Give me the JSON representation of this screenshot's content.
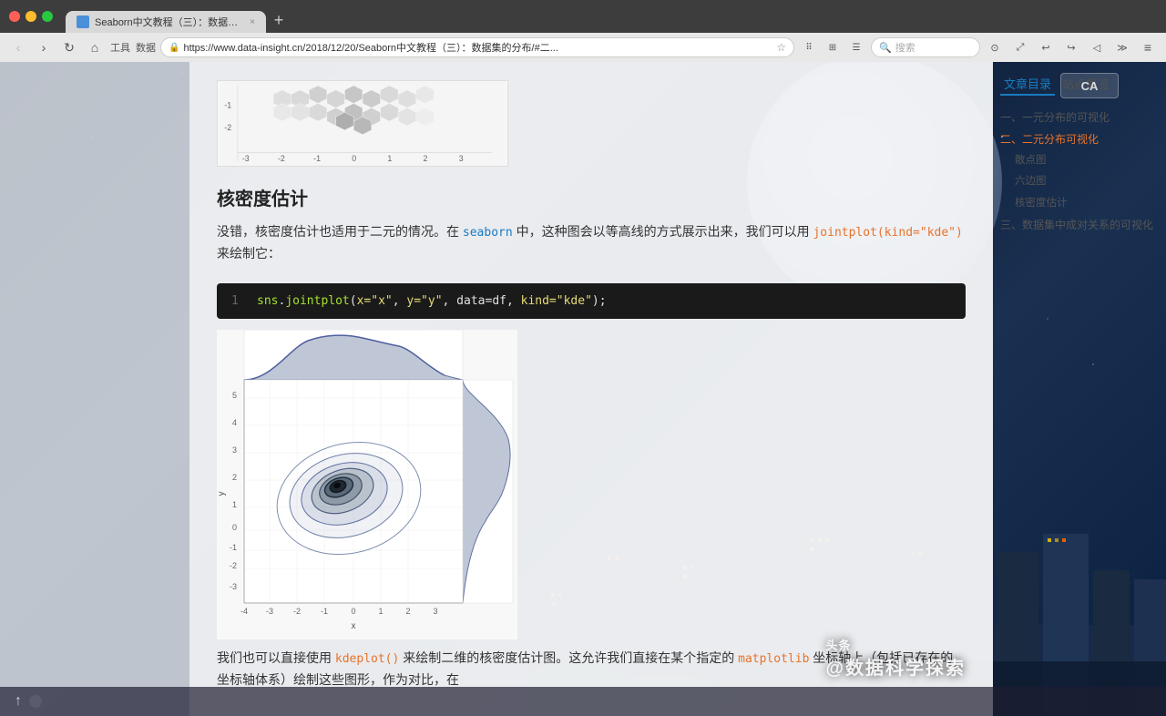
{
  "browser": {
    "tab_title": "Seaborn中文教程（三）：数据集...",
    "tab_close": "×",
    "new_tab": "+",
    "nav": {
      "back": "‹",
      "forward": "›",
      "reload": "↻",
      "home": "⌂",
      "tools": "工具",
      "data": "数据"
    },
    "url": "https://www.data-insight.cn/2018/12/20/Seaborn中文教程（三）：数据集的分布/#二...",
    "search_placeholder": "搜索"
  },
  "toc": {
    "tab1": "文章目录",
    "tab2": "站点概览",
    "items": [
      {
        "label": "一、一元分布的可视化",
        "level": 1,
        "active": false
      },
      {
        "label": "二、二元分布可视化",
        "level": 1,
        "active": true
      },
      {
        "label": "散点图",
        "level": 2,
        "active": false
      },
      {
        "label": "六边图",
        "level": 2,
        "active": false
      },
      {
        "label": "核密度估计",
        "level": 2,
        "active": false
      },
      {
        "label": "三、数据集中成对关系的可视化",
        "level": 1,
        "active": false
      }
    ]
  },
  "article": {
    "heading": "核密度估计",
    "para1": "没错，核密度估计也适用于二元的情况。在",
    "seaborn_link": "seaborn",
    "para1_cont": "中，这种图会以等高线的方式展示出来，我们可以用",
    "jointplot_code": "jointplot(kind=\"kde\")",
    "para1_end": "来绘制它：",
    "code_line": "1",
    "code_content": "sns.jointplot(x=\"x\", y=\"y\", data=df, kind=\"kde\");",
    "para2": "我们也可以直接使用",
    "kdeplot_code": "kdeplot()",
    "para2_cont": "来绘制二维的核密度估计图。这允许我们直接在某个指定的",
    "matplotlibcode": "matplotlib",
    "para2_end": "坐标轴上（包括已存在的坐标轴体系）绘制这些图形，作为对比，在"
  },
  "watermark": {
    "title": "头条 @数据科学探索",
    "sub": "@数据科学探索"
  },
  "ca_badge": "CA",
  "chart": {
    "x_axis": [
      -4,
      -3,
      -2,
      -1,
      0,
      1,
      2,
      3
    ],
    "y_axis": [
      -3,
      -2,
      -1,
      0,
      1,
      2,
      3,
      4,
      5
    ],
    "top_hex": {
      "axis_labels": [
        -3,
        -2,
        -1,
        0,
        1,
        2,
        3
      ],
      "y_labels": [
        -1,
        -2
      ]
    }
  }
}
